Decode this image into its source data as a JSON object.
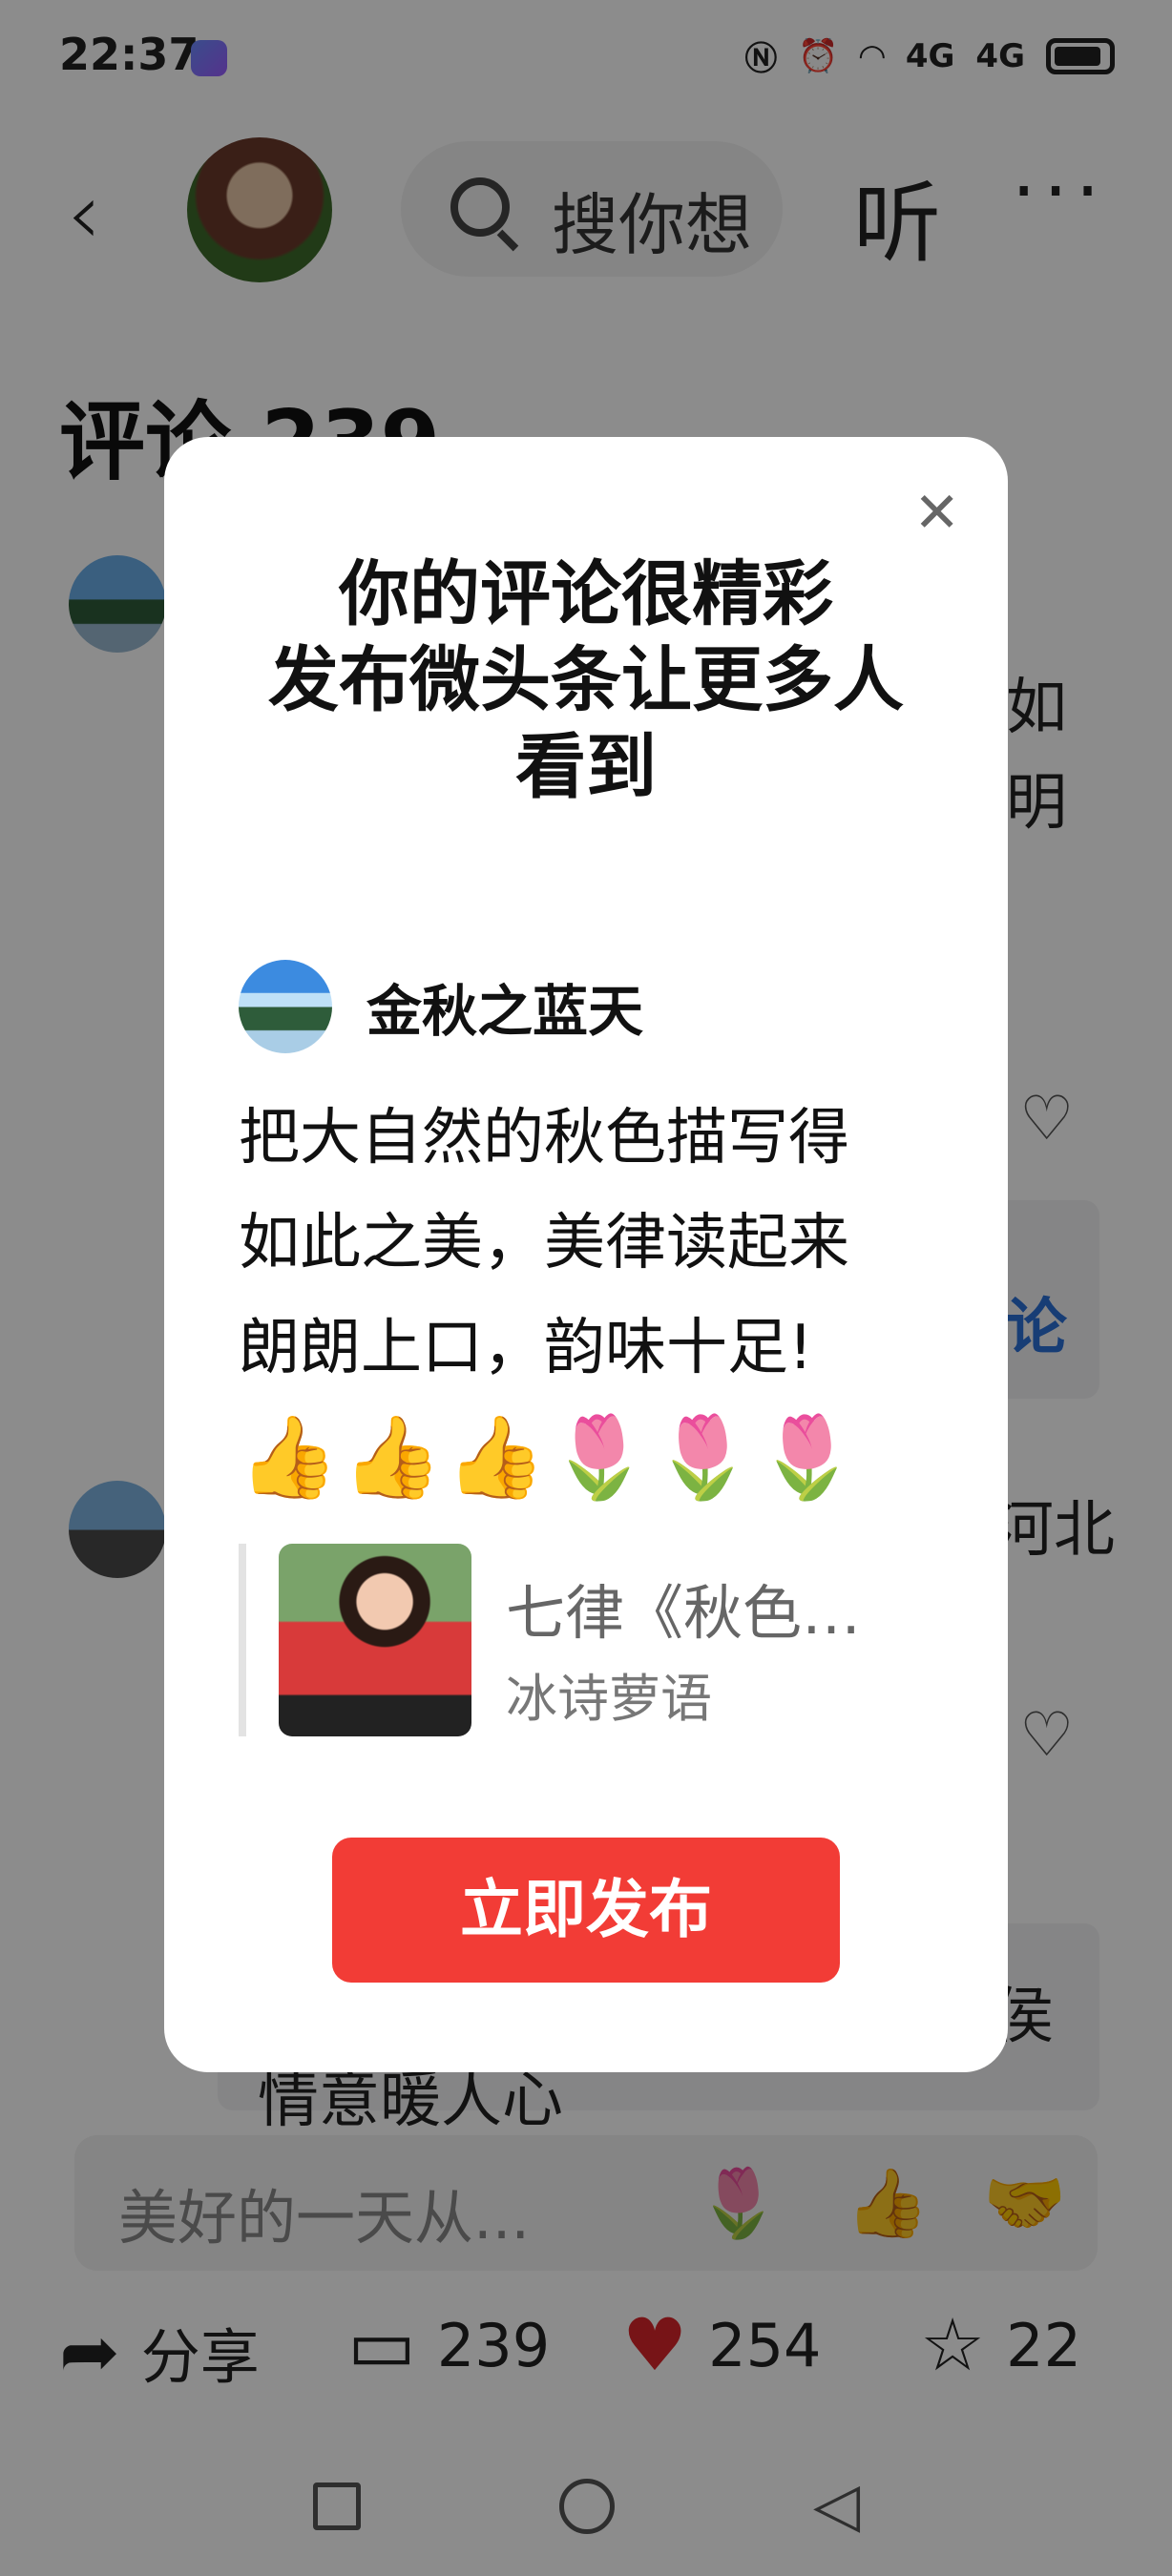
{
  "status_bar": {
    "time": "22:37",
    "network1": "4G",
    "network2": "4G"
  },
  "header": {
    "back_icon": "‹",
    "search_placeholder": "搜你想",
    "listen_label": "听",
    "more_icon": "···"
  },
  "comments": {
    "title": "评论 239",
    "bg_fragments": [
      "如",
      "明",
      "论",
      "河北",
      "侯",
      "情意暖人心"
    ]
  },
  "modal": {
    "close_icon": "✕",
    "title_lines": [
      "你的评论很精彩",
      "发布微头条让更多人",
      "看到"
    ],
    "author_name": "金秋之蓝天",
    "comment_lines": [
      "把大自然的秋色描写得",
      "如此之美，美律读起来",
      "朗朗上口，韵味十足!"
    ],
    "comment_emojis": "👍👍👍🌷🌷🌷",
    "quote_title": "七律《秋色…",
    "quote_author": "冰诗萝语",
    "publish_label": "立即发布"
  },
  "input_bar": {
    "placeholder": "美好的一天从...",
    "quick_emojis": [
      "🌷",
      "👍",
      "🤝"
    ]
  },
  "bottom_actions": {
    "share_label": "分享",
    "comment_count": "239",
    "like_count": "254",
    "favorite_count": "22"
  },
  "colors": {
    "accent_red": "#f23c36",
    "like_red": "#d9262b",
    "link_blue": "#2b6fd6"
  }
}
